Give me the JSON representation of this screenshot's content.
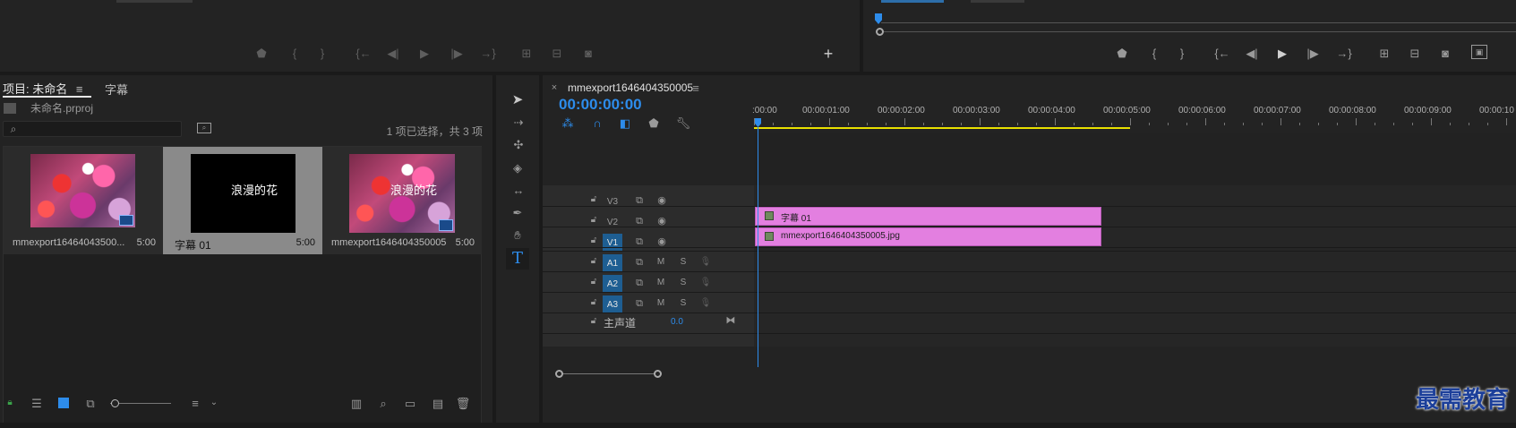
{
  "project_panel": {
    "tabs": [
      "项目: 未命名",
      "字幕"
    ],
    "project_file": "未命名.prproj",
    "selection_status": "1 项已选择，共 3 项",
    "items": [
      {
        "name": "mmexport16464043500...",
        "duration": "5:00",
        "type": "image"
      },
      {
        "name": "字幕 01",
        "duration": "5:00",
        "type": "title",
        "preview_text": "浪漫的花"
      },
      {
        "name": "mmexport1646404350005",
        "duration": "5:00",
        "type": "sequence",
        "overlay_text": "浪漫的花"
      }
    ]
  },
  "sequence_panel": {
    "sequence_tab": "mmexport1646404350005",
    "timecode": "00:00:00:00",
    "ruler_labels": [
      ":00:00",
      "00:00:01:00",
      "00:00:02:00",
      "00:00:03:00",
      "00:00:04:00",
      "00:00:05:00",
      "00:00:06:00",
      "00:00:07:00",
      "00:00:08:00",
      "00:00:09:00",
      "00:00:10"
    ],
    "video_tracks": [
      "V3",
      "V2",
      "V1"
    ],
    "audio_tracks": [
      "A1",
      "A2",
      "A3"
    ],
    "mute_label": "M",
    "solo_label": "S",
    "master_track": "主声道",
    "master_value": "0.0",
    "clips": [
      {
        "track": "V2",
        "label": "字幕 01"
      },
      {
        "track": "V1",
        "label": "mmexport1646404350005.jpg"
      }
    ]
  },
  "colors": {
    "accent": "#2d8ceb",
    "clip": "#e37fe0",
    "work_area": "#e8e000",
    "track_target": "#1e5e92"
  },
  "watermark": "最需教育"
}
